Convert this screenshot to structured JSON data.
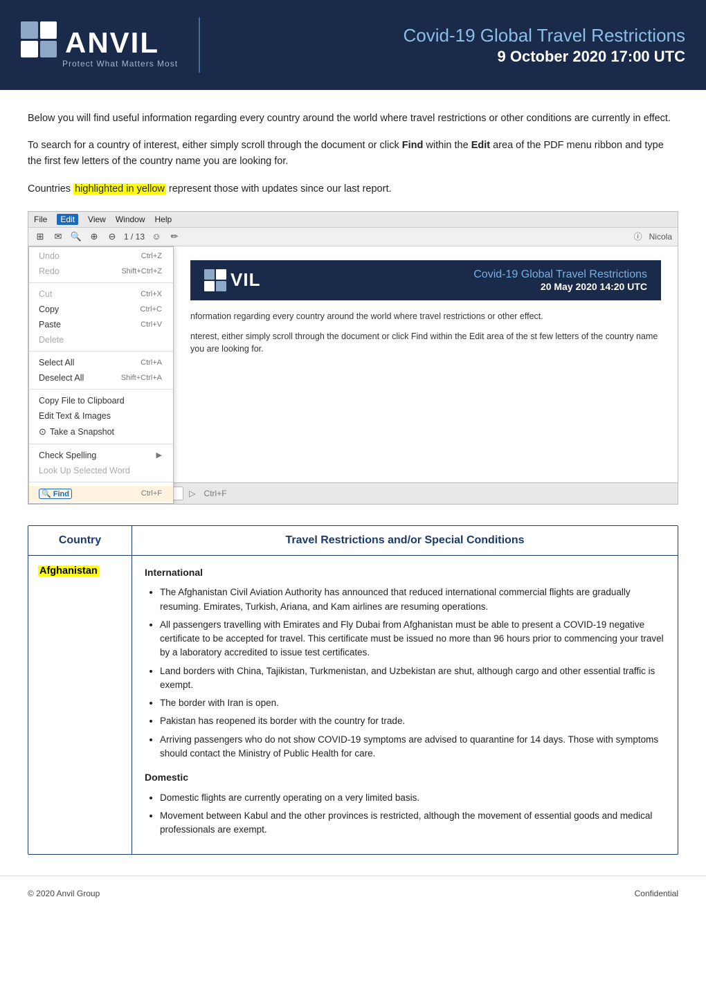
{
  "header": {
    "logo_text": "ANVIL",
    "logo_subtitle": "Protect What Matters Most",
    "title_line1": "Covid-19 Global Travel Restrictions",
    "title_line2": "9 October 2020 17:00 UTC"
  },
  "intro": {
    "paragraph1": "Below you will find useful information regarding every country around the world where travel restrictions or other conditions are currently in effect.",
    "paragraph2_pre": "To search for a country of interest, either simply scroll through the document or click ",
    "paragraph2_find": "Find",
    "paragraph2_mid": " within the ",
    "paragraph2_edit": "Edit",
    "paragraph2_post": " area of the PDF menu ribbon and type the first few letters of the country name you are looking for.",
    "paragraph3_pre": "Countries ",
    "paragraph3_highlight": "highlighted in yellow",
    "paragraph3_post": " represent those with updates since our last report."
  },
  "pdf_screenshot": {
    "menu_bar": [
      "File",
      "Edit",
      "View",
      "Window",
      "Help"
    ],
    "active_menu": "Edit",
    "menu_items": [
      {
        "label": "Undo",
        "shortcut": "Ctrl+Z",
        "disabled": true
      },
      {
        "label": "Redo",
        "shortcut": "Shift+Ctrl+Z",
        "disabled": true
      },
      {
        "separator": true
      },
      {
        "label": "Cut",
        "shortcut": "Ctrl+X"
      },
      {
        "label": "Copy",
        "shortcut": "Ctrl+C"
      },
      {
        "label": "Paste",
        "shortcut": "Ctrl+V"
      },
      {
        "label": "Delete",
        "shortcut": "",
        "disabled": true
      },
      {
        "separator": true
      },
      {
        "label": "Select All",
        "shortcut": "Ctrl+A"
      },
      {
        "label": "Deselect All",
        "shortcut": "Shift+Ctrl+A"
      },
      {
        "separator": true
      },
      {
        "label": "Copy File to Clipboard",
        "shortcut": ""
      },
      {
        "separator": false
      },
      {
        "label": "Edit Text & Images",
        "shortcut": ""
      },
      {
        "separator": false
      },
      {
        "label": "Take a Snapshot",
        "shortcut": ""
      },
      {
        "separator": true
      },
      {
        "label": "Check Spelling",
        "shortcut": "▶",
        "arrow": true
      },
      {
        "label": "Look Up Selected Word",
        "shortcut": ""
      },
      {
        "separator": true
      },
      {
        "label": "Find",
        "shortcut": "Ctrl+F",
        "highlight": true
      }
    ],
    "inner_header_title": "Covid-19 Global Travel Restrictions",
    "inner_header_date": "20 May 2020 14:20 UTC",
    "inner_body_text1": "nformation regarding every country around the world where travel restrictions or other effect.",
    "inner_body_text2": "nterest, either simply scroll through the document or click Find within the Edit area of the st few letters of the country name you are looking for.",
    "find_label": "Find",
    "find_shortcut": "Ctrl+F",
    "toolbar_page": "1 / 13"
  },
  "table": {
    "header_country": "Country",
    "header_restrictions": "Travel Restrictions and/or Special Conditions",
    "rows": [
      {
        "country": "Afghanistan",
        "highlighted": true,
        "sections": [
          {
            "heading": "International",
            "bullets": [
              "The Afghanistan Civil Aviation Authority has announced that reduced international commercial flights are gradually resuming. Emirates, Turkish, Ariana, and Kam airlines are resuming operations.",
              "All passengers travelling with Emirates and Fly Dubai from Afghanistan must be able to present a COVID-19 negative certificate to be accepted for travel. This certificate must be issued no more than 96 hours prior to commencing your travel by a laboratory accredited to issue test certificates.",
              "Land borders with China, Tajikistan, Turkmenistan, and Uzbekistan are shut, although cargo and other essential traffic is exempt.",
              "The border with Iran is open.",
              "Pakistan has reopened its border with the country for trade.",
              "Arriving passengers who do not show COVID-19 symptoms are advised to quarantine for 14 days. Those with symptoms should contact the Ministry of Public Health for care."
            ]
          },
          {
            "heading": "Domestic",
            "bullets": [
              "Domestic flights are currently operating on a very limited basis.",
              "Movement between Kabul and the other provinces is restricted, although the movement of essential goods and medical professionals are exempt."
            ]
          }
        ]
      }
    ]
  },
  "footer": {
    "copyright": "© 2020 Anvil Group",
    "confidential": "Confidential"
  }
}
